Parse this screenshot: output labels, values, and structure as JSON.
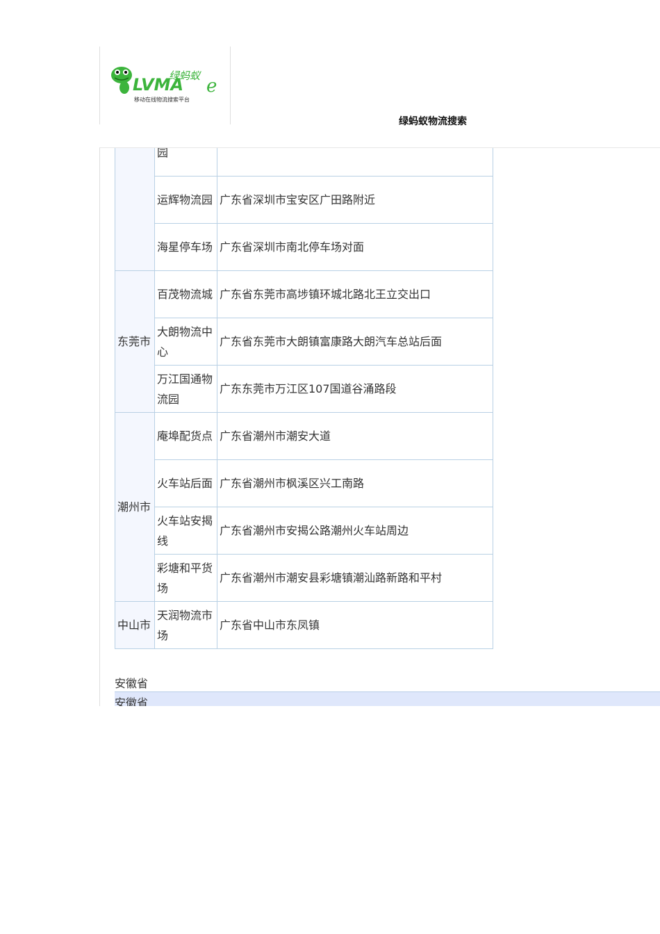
{
  "header": {
    "logo_text": "绿蚂蚁 LVMAe",
    "logo_tagline": "移动在线物流搜索平台",
    "site_title": "绿蚂蚁物流搜索"
  },
  "table": {
    "groups": [
      {
        "city": "",
        "rows": [
          {
            "name": "园",
            "address": ""
          },
          {
            "name": "运辉物流园",
            "address": "广东省深圳市宝安区广田路附近"
          },
          {
            "name": "海星停车场",
            "address": "广东省深圳市南北停车场对面"
          }
        ]
      },
      {
        "city": "东莞市",
        "rows": [
          {
            "name": "百茂物流城",
            "address": "广东省东莞市高埗镇环城北路北王立交出口"
          },
          {
            "name": "大朗物流中心",
            "address": "广东省东莞市大朗镇富康路大朗汽车总站后面"
          },
          {
            "name": "万江国通物流园",
            "address": "广东东莞市万江区107国道谷涌路段"
          }
        ]
      },
      {
        "city": "潮州市",
        "rows": [
          {
            "name": "庵埠配货点",
            "address": "广东省潮州市潮安大道"
          },
          {
            "name": "火车站后面",
            "address": "广东省潮州市枫溪区兴工南路"
          },
          {
            "name": "火车站安揭线",
            "address": "广东省潮州市安揭公路潮州火车站周边"
          },
          {
            "name": "彩塘和平货场",
            "address": "广东省潮州市潮安县彩塘镇潮汕路新路和平村"
          }
        ]
      },
      {
        "city": "中山市",
        "rows": [
          {
            "name": "天润物流市场",
            "address": "广东省中山市东凤镇"
          }
        ]
      }
    ]
  },
  "next_section": {
    "heading": "安徽省",
    "bar_label": "安徽省"
  },
  "colors": {
    "border": "#b8d0e4",
    "city_bg": "#f4f7fe",
    "bar_bg": "#dfe7fb",
    "logo_green": "#3cb43c"
  }
}
